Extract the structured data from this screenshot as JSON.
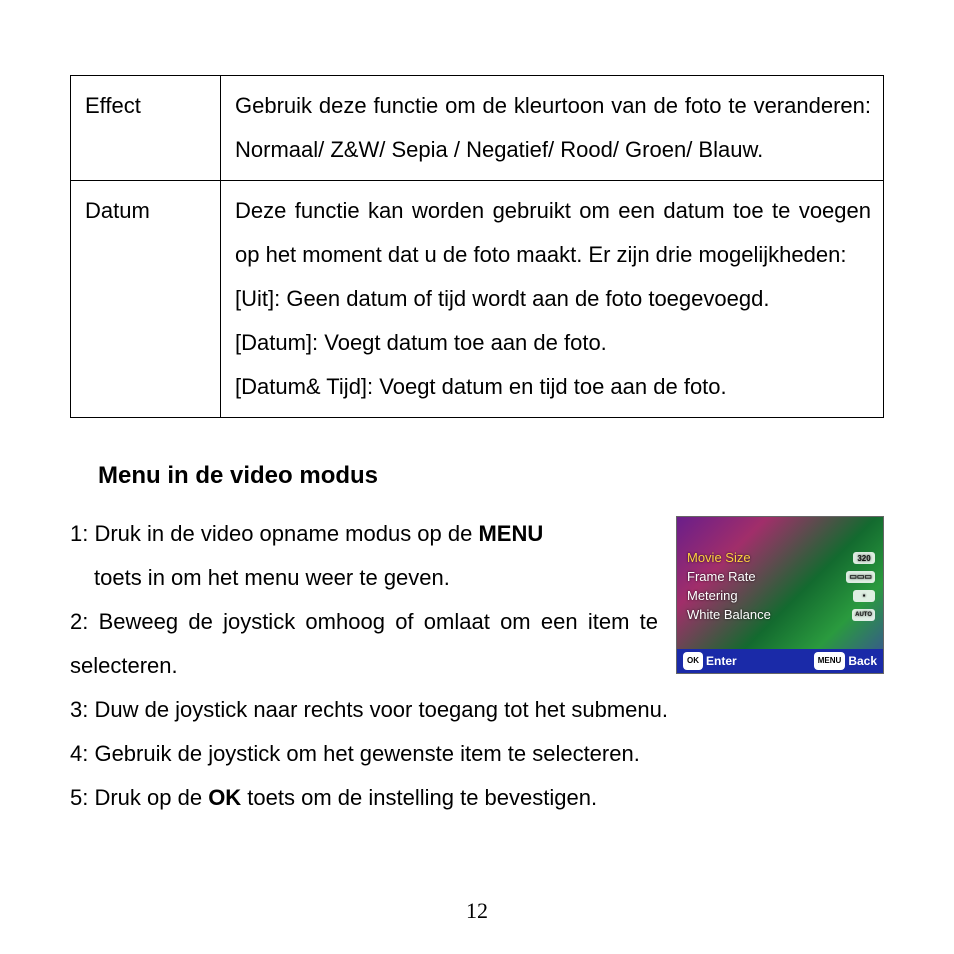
{
  "table": {
    "rows": [
      {
        "label": "Effect",
        "desc": "Gebruik deze functie om de kleurtoon van de foto te veranderen: Normaal/ Z&W/ Sepia / Negatief/ Rood/ Groen/ Blauw."
      },
      {
        "label": "Datum",
        "desc_intro": "Deze functie kan worden gebruikt om een datum toe te voegen op het moment dat u de foto maakt. Er zijn drie mogelijkheden:",
        "opt1": "[Uit]: Geen datum of tijd wordt aan de foto toegevoegd.",
        "opt2": "[Datum]: Voegt datum toe aan de foto.",
        "opt3": "[Datum& Tijd]: Voegt datum en tijd toe aan de foto."
      }
    ]
  },
  "section": {
    "title": "Menu in de video modus",
    "step1a": "1: Druk in de video opname modus op de ",
    "step1b": "MENU",
    "step1c": " toets in om het menu weer te geven.",
    "step2": "2: Beweeg de joystick omhoog of omlaat om een item te selecteren.",
    "step3": "3: Duw de joystick naar rechts voor toegang tot het submenu.",
    "step4": "4: Gebruik de joystick om het gewenste item te selecteren.",
    "step5a": "5: Druk op de ",
    "step5b": "OK",
    "step5c": " toets om de instelling te bevestigen."
  },
  "video_menu": {
    "items": [
      {
        "label": "Movie Size",
        "badge": "320",
        "selected": true
      },
      {
        "label": "Frame Rate",
        "badge": "▭▭▭",
        "selected": false
      },
      {
        "label": "Metering",
        "badge": "▪",
        "selected": false
      },
      {
        "label": "White Balance",
        "badge": "AUTO",
        "selected": false
      }
    ],
    "footer": {
      "ok_key": "OK",
      "ok_label": "Enter",
      "menu_key": "MENU",
      "menu_label": "Back"
    }
  },
  "page_number": "12"
}
